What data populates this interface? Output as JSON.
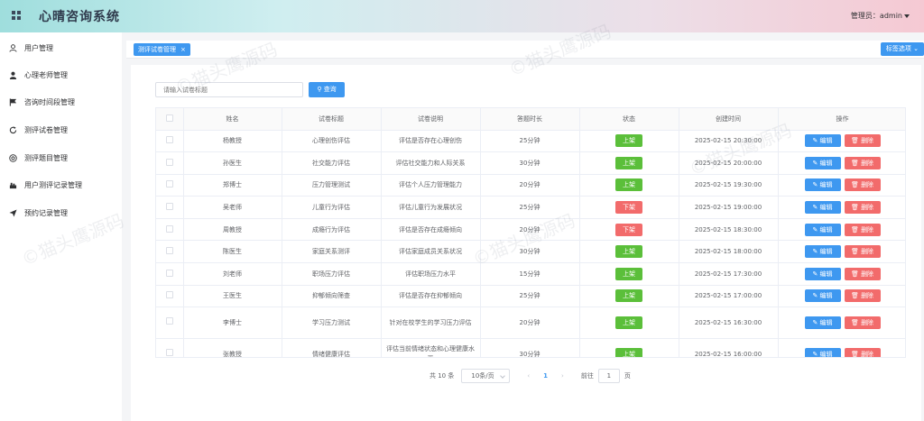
{
  "header": {
    "brand": "心晴咨询系统",
    "admin_label": "管理员：admin"
  },
  "sidebar": {
    "items": [
      {
        "label": "用户管理",
        "icon": "user-icon"
      },
      {
        "label": "心理老师管理",
        "icon": "person-icon"
      },
      {
        "label": "咨询时间段管理",
        "icon": "flag-icon"
      },
      {
        "label": "测评试卷管理",
        "icon": "refresh-icon"
      },
      {
        "label": "测评题目管理",
        "icon": "help-circle-icon"
      },
      {
        "label": "用户测评记录管理",
        "icon": "chart-icon"
      },
      {
        "label": "预约记录管理",
        "icon": "send-icon"
      }
    ]
  },
  "tabs": {
    "active_label": "测评试卷管理",
    "close": "×",
    "options_label": "标签选项"
  },
  "search": {
    "placeholder": "请输入试卷标题",
    "button_label": "查询"
  },
  "table": {
    "headers": [
      "姓名",
      "试卷标题",
      "试卷说明",
      "答题时长",
      "状态",
      "创建时间",
      "操作"
    ],
    "edit_label": "编辑",
    "delete_label": "删除",
    "rows": [
      {
        "name": "杨教授",
        "title": "心理创伤评估",
        "desc": "评估是否存在心理创伤",
        "duration": "25分钟",
        "status": "上架",
        "created": "2025-02-15 20:30:00"
      },
      {
        "name": "孙医生",
        "title": "社交能力评估",
        "desc": "评估社交能力和人际关系",
        "duration": "30分钟",
        "status": "上架",
        "created": "2025-02-15 20:00:00"
      },
      {
        "name": "郑博士",
        "title": "压力管理测试",
        "desc": "评估个人压力管理能力",
        "duration": "20分钟",
        "status": "上架",
        "created": "2025-02-15 19:30:00"
      },
      {
        "name": "吴老师",
        "title": "儿童行为评估",
        "desc": "评估儿童行为发展状况",
        "duration": "25分钟",
        "status": "下架",
        "created": "2025-02-15 19:00:00"
      },
      {
        "name": "周教授",
        "title": "成瘾行为评估",
        "desc": "评估是否存在成瘾倾向",
        "duration": "20分钟",
        "status": "下架",
        "created": "2025-02-15 18:30:00"
      },
      {
        "name": "陈医生",
        "title": "家庭关系测评",
        "desc": "评估家庭成员关系状况",
        "duration": "30分钟",
        "status": "上架",
        "created": "2025-02-15 18:00:00"
      },
      {
        "name": "刘老师",
        "title": "职场压力评估",
        "desc": "评估职场压力水平",
        "duration": "15分钟",
        "status": "上架",
        "created": "2025-02-15 17:30:00"
      },
      {
        "name": "王医生",
        "title": "抑郁倾向筛查",
        "desc": "评估是否存在抑郁倾向",
        "duration": "25分钟",
        "status": "上架",
        "created": "2025-02-15 17:00:00"
      },
      {
        "name": "李博士",
        "title": "学习压力测试",
        "desc": "针对在校学生的学习压力评估",
        "duration": "20分钟",
        "status": "上架",
        "created": "2025-02-15 16:30:00"
      },
      {
        "name": "张教授",
        "title": "情绪健康评估",
        "desc": "评估当前情绪状态和心理健康水平",
        "duration": "30分钟",
        "status": "上架",
        "created": "2025-02-15 16:00:00"
      }
    ]
  },
  "pagination": {
    "total": "共 10 条",
    "page_size": "10条/页",
    "prev": "‹",
    "current": "1",
    "next": "›",
    "goto_label": "前往",
    "goto_value": "1",
    "page_unit": "页"
  },
  "colors": {
    "primary": "#3e98f0",
    "success": "#5bbf3a",
    "danger": "#f26b6b"
  }
}
